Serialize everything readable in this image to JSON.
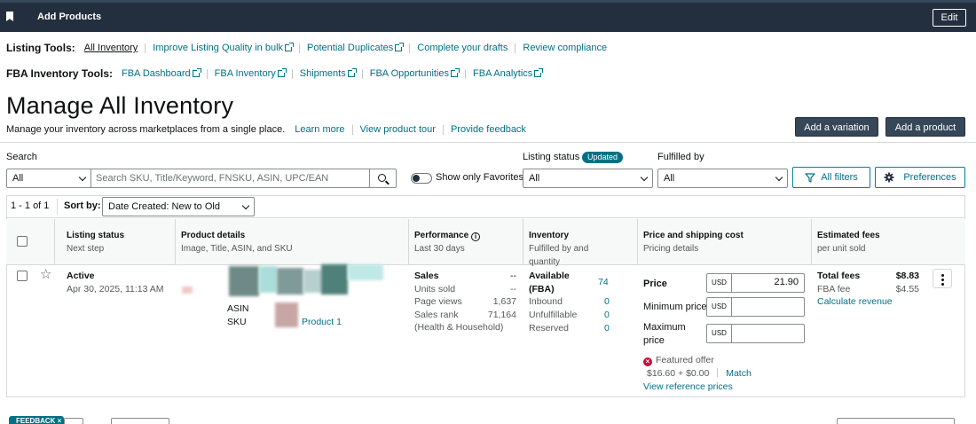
{
  "topbar": {
    "title": "Add Products",
    "edit_label": "Edit"
  },
  "listing_tools": {
    "label": "Listing Tools:",
    "links": [
      "All Inventory",
      "Improve Listing Quality in bulk",
      "Potential Duplicates",
      "Complete your drafts",
      "Review compliance"
    ]
  },
  "fba_tools": {
    "label": "FBA Inventory Tools:",
    "links": [
      "FBA Dashboard",
      "FBA Inventory",
      "Shipments",
      "FBA Opportunities",
      "FBA Analytics"
    ]
  },
  "page": {
    "title": "Manage All Inventory",
    "description": "Manage your inventory across marketplaces from a single place.",
    "links": [
      "Learn more",
      "View product tour",
      "Provide feedback"
    ],
    "add_variation": "Add a variation",
    "add_product": "Add a product"
  },
  "filters": {
    "search_label": "Search",
    "search_scope": "All",
    "search_placeholder": "Search SKU, Title/Keyword, FNSKU, ASIN, UPC/EAN",
    "favorites_label": "Show only Favorites",
    "listing_status_label": "Listing status",
    "listing_status_badge": "Updated",
    "listing_status_value": "All",
    "fulfilled_by_label": "Fulfilled by",
    "fulfilled_by_value": "All",
    "all_filters": "All filters",
    "preferences": "Preferences"
  },
  "pager": {
    "count": "1 - 1 of 1",
    "sort_label": "Sort by:",
    "sort_value": "Date Created: New to Old"
  },
  "columns": [
    {
      "title": "Listing status",
      "sub": "Next step"
    },
    {
      "title": "Product details",
      "sub": "Image, Title, ASIN, and SKU"
    },
    {
      "title": "Performance",
      "sub": "Last 30 days"
    },
    {
      "title": "Inventory",
      "sub": "Fulfilled by and quantity"
    },
    {
      "title": "Price and shipping cost",
      "sub": "Pricing details"
    },
    {
      "title": "Estimated fees",
      "sub": "per unit sold"
    }
  ],
  "row": {
    "status": "Active",
    "date": "Apr 30, 2025, 11:13 AM",
    "asin_label": "ASIN",
    "sku_label": "SKU",
    "product_link": "Product 1",
    "performance": {
      "sales_label": "Sales",
      "sales_value": "--",
      "units_label": "Units sold",
      "units_value": "--",
      "views_label": "Page views",
      "views_value": "1,637",
      "rank_label": "Sales rank",
      "rank_value": "71,164",
      "category": "(Health & Household)"
    },
    "inventory": {
      "available_label": "Available (FBA)",
      "available_value": "74",
      "inbound_label": "Inbound",
      "inbound_value": "0",
      "unfulfillable_label": "Unfulfillable",
      "unfulfillable_value": "0",
      "reserved_label": "Reserved",
      "reserved_value": "0"
    },
    "pricing": {
      "price_label": "Price",
      "currency": "USD",
      "price_value": "21.90",
      "min_label": "Minimum price",
      "max_label": "Maximum price",
      "featured_offer": "Featured offer",
      "featured_price": "$16.60 + $0.00",
      "match": "Match",
      "reference": "View reference prices"
    },
    "fees": {
      "total_label": "Total fees",
      "total_value": "$8.83",
      "fba_label": "FBA fee",
      "fba_value": "$4.55",
      "calculate": "Calculate revenue"
    }
  },
  "feedback_tab": "FEEDBACK ×"
}
